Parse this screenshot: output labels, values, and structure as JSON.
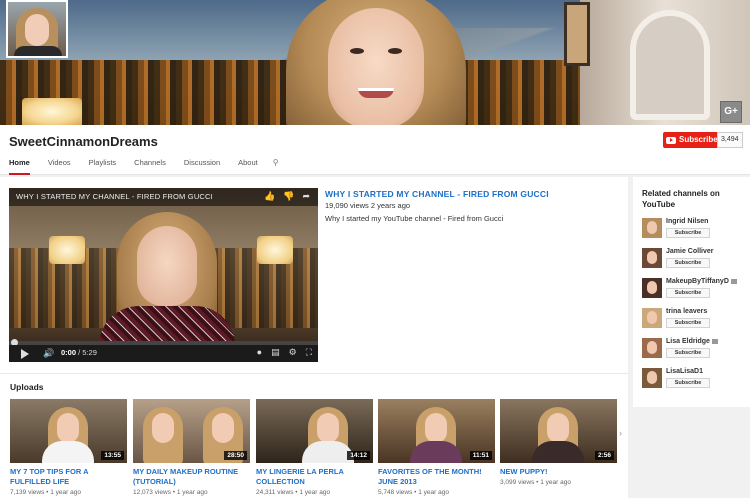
{
  "channel": {
    "name": "SweetCinnamonDreams",
    "subscribe_label": "Subscribe",
    "subscriber_count": "3,494"
  },
  "tabs": [
    "Home",
    "Videos",
    "Playlists",
    "Channels",
    "Discussion",
    "About"
  ],
  "active_tab": "Home",
  "featured": {
    "player_title": "WHY I STARTED MY CHANNEL - FIRED FROM GUCCI",
    "time_current": "0:00",
    "time_total": "5:29",
    "title": "WHY I STARTED MY CHANNEL - FIRED FROM GUCCI",
    "meta": "19,090 views  2 years ago",
    "description": "Why I started my YouTube channel - Fired from Gucci"
  },
  "uploads": {
    "heading": "Uploads",
    "items": [
      {
        "title": "MY 7 TOP TIPS FOR A FULFILLED LIFE",
        "duration": "13:55",
        "views": "7,139 views",
        "age": "1 year ago"
      },
      {
        "title": "MY DAILY MAKEUP ROUTINE (TUTORIAL)",
        "duration": "28:50",
        "views": "12,073 views",
        "age": "1 year ago"
      },
      {
        "title": "MY LINGERIE LA PERLA COLLECTION",
        "duration": "14:12",
        "views": "24,311 views",
        "age": "1 year ago"
      },
      {
        "title": "FAVORITES OF THE MONTH! JUNE 2013",
        "duration": "11:51",
        "views": "5,748 views",
        "age": "1 year ago"
      },
      {
        "title": "NEW PUPPY!",
        "duration": "2:56",
        "views": "3,099 views",
        "age": "1 year ago"
      }
    ]
  },
  "sidebar": {
    "heading": "Related channels on YouTube",
    "subscribe_label": "Subscribe",
    "channels": [
      {
        "name": "Ingrid Nilsen",
        "verified": false
      },
      {
        "name": "Jamie Colliver",
        "verified": false
      },
      {
        "name": "MakeupByTiffanyD",
        "verified": true
      },
      {
        "name": "trina leavers",
        "verified": false
      },
      {
        "name": "Lisa Eldridge",
        "verified": true
      },
      {
        "name": "LisaLisaD1",
        "verified": false
      }
    ]
  },
  "colors": {
    "accent_red": "#e62117",
    "link_blue": "#1f6fc7"
  },
  "icons": {
    "gplus": "G+"
  }
}
